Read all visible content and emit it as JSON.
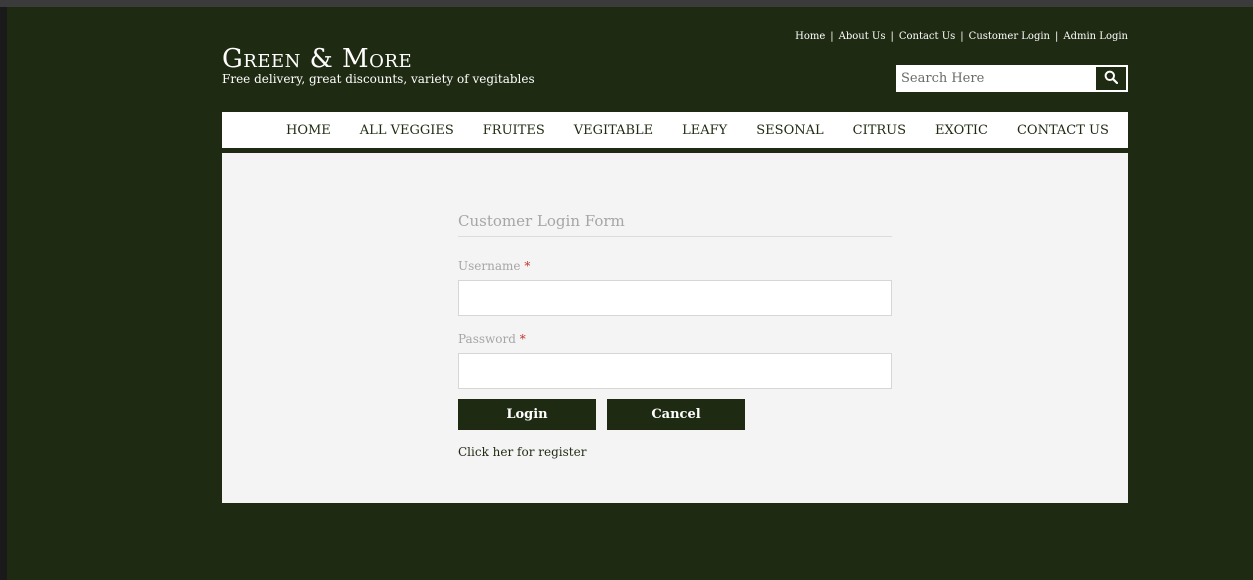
{
  "top_links": [
    {
      "label": "Home"
    },
    {
      "label": "About Us"
    },
    {
      "label": "Contact Us"
    },
    {
      "label": "Customer Login"
    },
    {
      "label": "Admin Login"
    }
  ],
  "brand": {
    "name": "Green & More",
    "tagline": "Free delivery, great discounts, variety of vegitables"
  },
  "search": {
    "placeholder": "Search Here",
    "icon": "search-icon"
  },
  "nav": [
    {
      "label": "HOME"
    },
    {
      "label": "ALL VEGGIES"
    },
    {
      "label": "FRUITES"
    },
    {
      "label": "VEGITABLE"
    },
    {
      "label": "LEAFY"
    },
    {
      "label": "SESONAL"
    },
    {
      "label": "CITRUS"
    },
    {
      "label": "EXOTIC"
    },
    {
      "label": "CONTACT US"
    }
  ],
  "form": {
    "title": "Customer Login Form",
    "username_label": "Username",
    "password_label": "Password",
    "required_mark": "*",
    "username_value": "",
    "password_value": "",
    "login_label": "Login",
    "cancel_label": "Cancel",
    "register_link": "Click her for register"
  },
  "colors": {
    "background": "#1f2a12",
    "button": "#1f2a12",
    "panel": "#f4f4f4",
    "required": "#c0392b"
  }
}
